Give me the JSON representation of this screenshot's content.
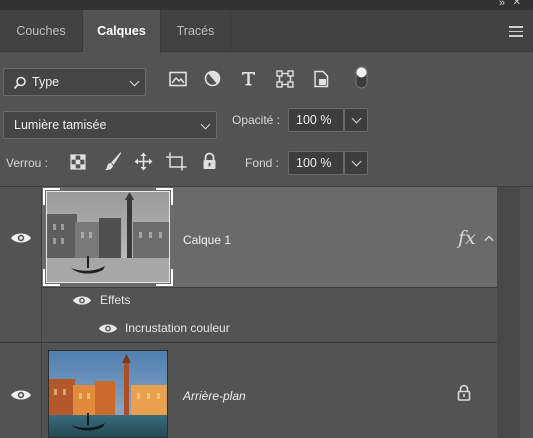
{
  "window": {
    "collapse_icon": "double-chevron-right-icon",
    "close_icon": "close-icon"
  },
  "tabs": [
    {
      "label": "Couches",
      "active": false
    },
    {
      "label": "Calques",
      "active": true
    },
    {
      "label": "Tracés",
      "active": false
    }
  ],
  "filter": {
    "kind_label": "Type",
    "icons": [
      "pixel-layer-filter-icon",
      "adjustment-layer-filter-icon",
      "type-layer-filter-icon",
      "shape-layer-filter-icon",
      "smart-object-filter-icon",
      "filter-toggle-icon"
    ]
  },
  "blend": {
    "mode": "Lumière tamisée",
    "opacity_label": "Opacité :",
    "opacity_value": "100 %"
  },
  "lock": {
    "label": "Verrou :",
    "icons": [
      "lock-transparent-pixels-icon",
      "lock-image-pixels-icon",
      "lock-position-icon",
      "lock-artboard-icon",
      "lock-all-icon"
    ],
    "fill_label": "Fond :",
    "fill_value": "100 %"
  },
  "layers": [
    {
      "name": "Calque 1",
      "selected": true,
      "fx": "fx",
      "effects_label": "Effets",
      "effects": [
        "Incrustation couleur"
      ]
    },
    {
      "name": "Arrière-plan",
      "selected": false,
      "locked": true
    }
  ],
  "colors": {
    "panel": "#535353",
    "tabbar": "#424242",
    "selected_row": "#6a6a6a"
  }
}
